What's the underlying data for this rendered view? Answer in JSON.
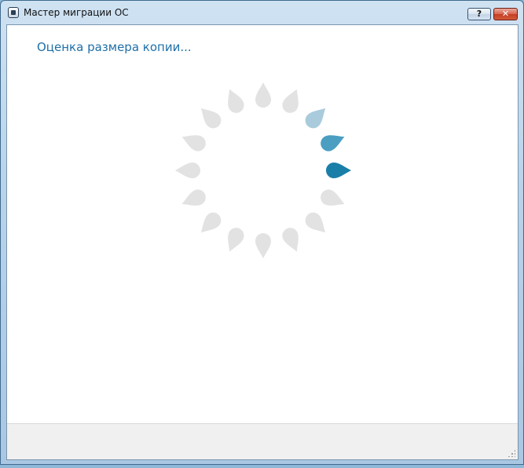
{
  "window": {
    "title": "Мастер миграции ОС",
    "help_label": "?",
    "close_label": "✕"
  },
  "icons": {
    "app": "migration-wizard-icon",
    "help": "help-icon",
    "close": "close-icon",
    "spinner": "loading-spinner-icon",
    "grip": "resize-grip-icon"
  },
  "main": {
    "status_heading": "Оценка размера копии..."
  },
  "colors": {
    "heading": "#1e6fa8",
    "spinner_active": "#1a7fa8",
    "spinner_mid": "#4a9ec2",
    "spinner_light": "#a9cbdc",
    "spinner_idle": "#e2e2e2"
  },
  "spinner": {
    "petal_count": 16,
    "active_petal_index": 4
  }
}
